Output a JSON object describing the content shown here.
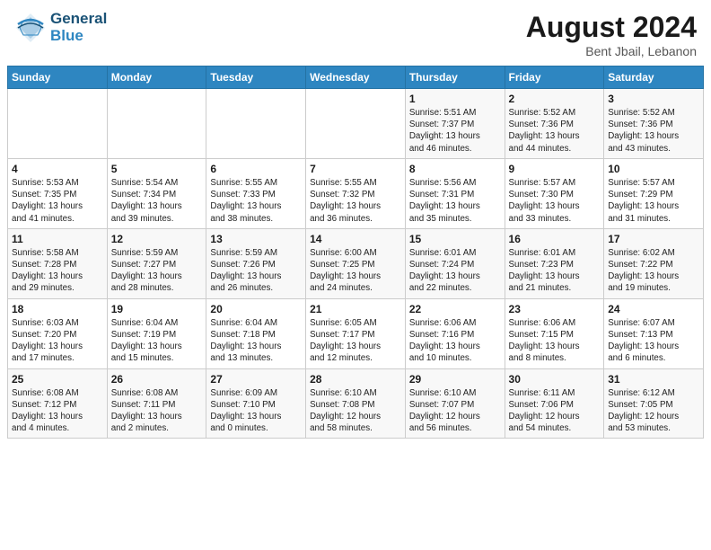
{
  "header": {
    "logo": {
      "line1": "General",
      "line2": "Blue"
    },
    "title": "August 2024",
    "subtitle": "Bent Jbail, Lebanon"
  },
  "weekdays": [
    "Sunday",
    "Monday",
    "Tuesday",
    "Wednesday",
    "Thursday",
    "Friday",
    "Saturday"
  ],
  "weeks": [
    [
      {
        "day": "",
        "info": ""
      },
      {
        "day": "",
        "info": ""
      },
      {
        "day": "",
        "info": ""
      },
      {
        "day": "",
        "info": ""
      },
      {
        "day": "1",
        "info": "Sunrise: 5:51 AM\nSunset: 7:37 PM\nDaylight: 13 hours\nand 46 minutes."
      },
      {
        "day": "2",
        "info": "Sunrise: 5:52 AM\nSunset: 7:36 PM\nDaylight: 13 hours\nand 44 minutes."
      },
      {
        "day": "3",
        "info": "Sunrise: 5:52 AM\nSunset: 7:36 PM\nDaylight: 13 hours\nand 43 minutes."
      }
    ],
    [
      {
        "day": "4",
        "info": "Sunrise: 5:53 AM\nSunset: 7:35 PM\nDaylight: 13 hours\nand 41 minutes."
      },
      {
        "day": "5",
        "info": "Sunrise: 5:54 AM\nSunset: 7:34 PM\nDaylight: 13 hours\nand 39 minutes."
      },
      {
        "day": "6",
        "info": "Sunrise: 5:55 AM\nSunset: 7:33 PM\nDaylight: 13 hours\nand 38 minutes."
      },
      {
        "day": "7",
        "info": "Sunrise: 5:55 AM\nSunset: 7:32 PM\nDaylight: 13 hours\nand 36 minutes."
      },
      {
        "day": "8",
        "info": "Sunrise: 5:56 AM\nSunset: 7:31 PM\nDaylight: 13 hours\nand 35 minutes."
      },
      {
        "day": "9",
        "info": "Sunrise: 5:57 AM\nSunset: 7:30 PM\nDaylight: 13 hours\nand 33 minutes."
      },
      {
        "day": "10",
        "info": "Sunrise: 5:57 AM\nSunset: 7:29 PM\nDaylight: 13 hours\nand 31 minutes."
      }
    ],
    [
      {
        "day": "11",
        "info": "Sunrise: 5:58 AM\nSunset: 7:28 PM\nDaylight: 13 hours\nand 29 minutes."
      },
      {
        "day": "12",
        "info": "Sunrise: 5:59 AM\nSunset: 7:27 PM\nDaylight: 13 hours\nand 28 minutes."
      },
      {
        "day": "13",
        "info": "Sunrise: 5:59 AM\nSunset: 7:26 PM\nDaylight: 13 hours\nand 26 minutes."
      },
      {
        "day": "14",
        "info": "Sunrise: 6:00 AM\nSunset: 7:25 PM\nDaylight: 13 hours\nand 24 minutes."
      },
      {
        "day": "15",
        "info": "Sunrise: 6:01 AM\nSunset: 7:24 PM\nDaylight: 13 hours\nand 22 minutes."
      },
      {
        "day": "16",
        "info": "Sunrise: 6:01 AM\nSunset: 7:23 PM\nDaylight: 13 hours\nand 21 minutes."
      },
      {
        "day": "17",
        "info": "Sunrise: 6:02 AM\nSunset: 7:22 PM\nDaylight: 13 hours\nand 19 minutes."
      }
    ],
    [
      {
        "day": "18",
        "info": "Sunrise: 6:03 AM\nSunset: 7:20 PM\nDaylight: 13 hours\nand 17 minutes."
      },
      {
        "day": "19",
        "info": "Sunrise: 6:04 AM\nSunset: 7:19 PM\nDaylight: 13 hours\nand 15 minutes."
      },
      {
        "day": "20",
        "info": "Sunrise: 6:04 AM\nSunset: 7:18 PM\nDaylight: 13 hours\nand 13 minutes."
      },
      {
        "day": "21",
        "info": "Sunrise: 6:05 AM\nSunset: 7:17 PM\nDaylight: 13 hours\nand 12 minutes."
      },
      {
        "day": "22",
        "info": "Sunrise: 6:06 AM\nSunset: 7:16 PM\nDaylight: 13 hours\nand 10 minutes."
      },
      {
        "day": "23",
        "info": "Sunrise: 6:06 AM\nSunset: 7:15 PM\nDaylight: 13 hours\nand 8 minutes."
      },
      {
        "day": "24",
        "info": "Sunrise: 6:07 AM\nSunset: 7:13 PM\nDaylight: 13 hours\nand 6 minutes."
      }
    ],
    [
      {
        "day": "25",
        "info": "Sunrise: 6:08 AM\nSunset: 7:12 PM\nDaylight: 13 hours\nand 4 minutes."
      },
      {
        "day": "26",
        "info": "Sunrise: 6:08 AM\nSunset: 7:11 PM\nDaylight: 13 hours\nand 2 minutes."
      },
      {
        "day": "27",
        "info": "Sunrise: 6:09 AM\nSunset: 7:10 PM\nDaylight: 13 hours\nand 0 minutes."
      },
      {
        "day": "28",
        "info": "Sunrise: 6:10 AM\nSunset: 7:08 PM\nDaylight: 12 hours\nand 58 minutes."
      },
      {
        "day": "29",
        "info": "Sunrise: 6:10 AM\nSunset: 7:07 PM\nDaylight: 12 hours\nand 56 minutes."
      },
      {
        "day": "30",
        "info": "Sunrise: 6:11 AM\nSunset: 7:06 PM\nDaylight: 12 hours\nand 54 minutes."
      },
      {
        "day": "31",
        "info": "Sunrise: 6:12 AM\nSunset: 7:05 PM\nDaylight: 12 hours\nand 53 minutes."
      }
    ]
  ]
}
